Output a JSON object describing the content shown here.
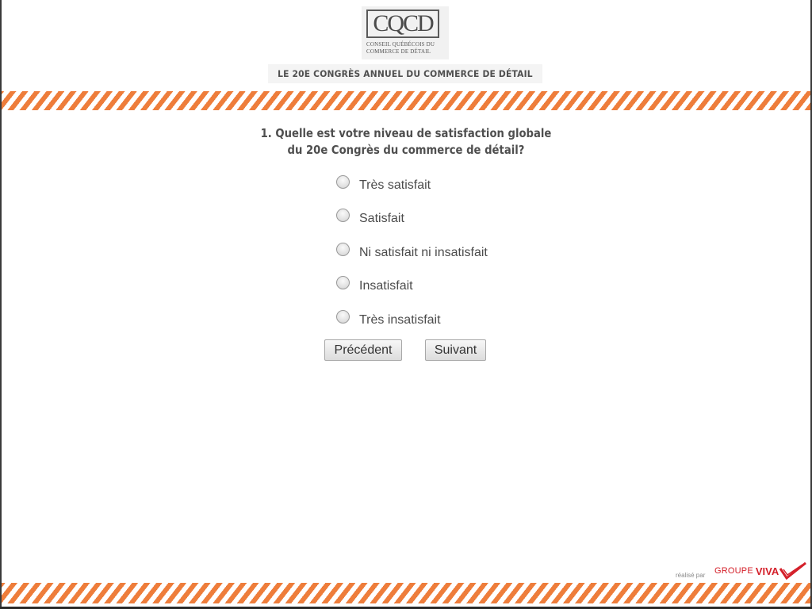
{
  "logo": {
    "mark": "CQCD",
    "line1": "CONSEIL QUÉBÉCOIS DU",
    "line2": "COMMERCE DE DÉTAIL"
  },
  "banner": {
    "title": "LE 20E CONGRÈS ANNUEL DU COMMERCE DE DÉTAIL"
  },
  "question": {
    "line1": "1. Quelle est votre niveau de satisfaction globale",
    "line2": "du 20e Congrès du commerce de détail?"
  },
  "options": [
    {
      "label": "Très satisfait",
      "selected": false
    },
    {
      "label": "Satisfait",
      "selected": false
    },
    {
      "label": "Ni satisfait ni insatisfait",
      "selected": false
    },
    {
      "label": "Insatisfait",
      "selected": false
    },
    {
      "label": "Très insatisfait",
      "selected": false
    }
  ],
  "buttons": {
    "previous": "Précédent",
    "next": "Suivant"
  },
  "footer": {
    "credit": "réalisé par",
    "brand_groupe": "GROUPE",
    "brand_viva": "VIVA"
  },
  "colors": {
    "stripe": "#ee7d3b",
    "text": "#4f4f4f",
    "brand": "#d4202a"
  }
}
